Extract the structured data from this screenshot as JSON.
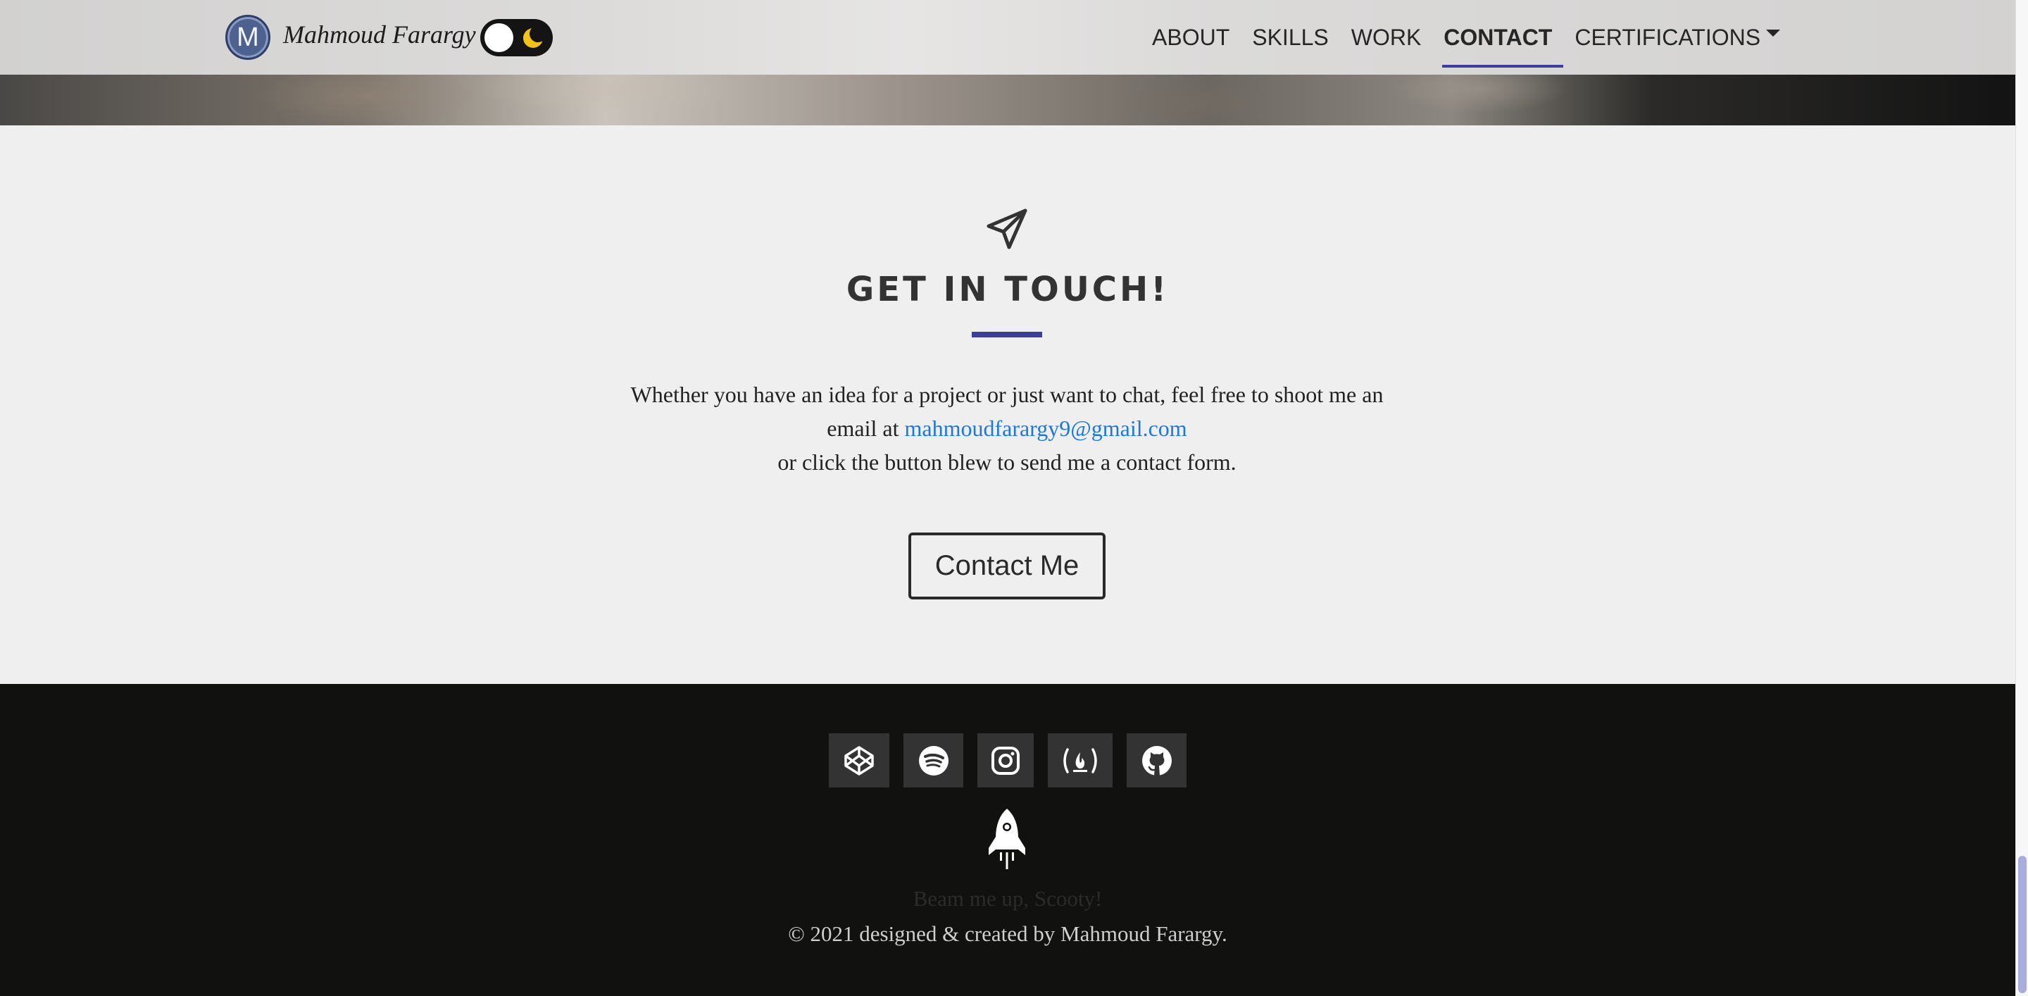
{
  "navbar": {
    "brand_initial": "M",
    "brand_name": "Mahmoud Farargy",
    "links": [
      {
        "label": "ABOUT"
      },
      {
        "label": "SKILLS"
      },
      {
        "label": "WORK"
      },
      {
        "label": "CONTACT"
      },
      {
        "label": "CERTIFICATIONS"
      }
    ],
    "active_link": "CONTACT",
    "accent_color": "#3b3f9a"
  },
  "contact": {
    "icon": "paper-plane-icon",
    "title": "GET IN TOUCH!",
    "text_before_email": "Whether you have an idea for a project or just want to chat, feel free to shoot me an email at ",
    "email": "mahmoudfarargy9@gmail.com",
    "text_after_email": "or click the button blew to send me a contact form.",
    "button_label": "Contact Me"
  },
  "footer": {
    "social_icons": [
      "codepen-icon",
      "spotify-icon",
      "instagram-icon",
      "freecodecamp-icon",
      "github-icon"
    ],
    "rocket_icon": "rocket-icon",
    "tagline": "Beam me up, Scooty!",
    "copyright": "© 2021 designed & created by Mahmoud Farargy."
  }
}
